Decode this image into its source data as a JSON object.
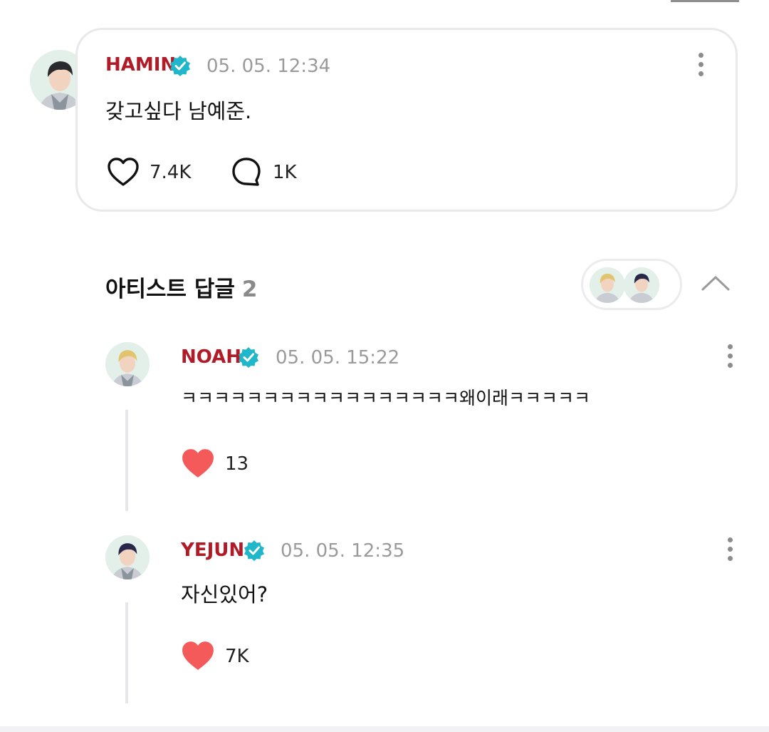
{
  "post": {
    "author": "HAMIN",
    "author_color": "#b11a27",
    "verified_color": "#1fb7c9",
    "timestamp": "05. 05. 12:34",
    "text": "갖고싶다 남예준.",
    "likes": "7.4K",
    "comments": "1K",
    "icons": {
      "like": "heart-outline-icon",
      "comment": "comment-bubble-icon",
      "more": "more-vertical-icon"
    }
  },
  "replies_section": {
    "title": "아티스트 답글",
    "count": "2",
    "participant_avatars": [
      "NOAH",
      "YEJUN"
    ]
  },
  "replies": [
    {
      "author": "NOAH",
      "timestamp": "05. 05. 15:22",
      "text": "ㅋㅋㅋㅋㅋㅋㅋㅋㅋㅋㅋㅋㅋㅋㅋㅋㅋ왜이래ㅋㅋㅋㅋㅋ",
      "likes": "13",
      "liked": true
    },
    {
      "author": "YEJUN",
      "timestamp": "05. 05. 12:35",
      "text": "자신있어?",
      "likes": "7K",
      "liked": true
    }
  ],
  "colors": {
    "heart_filled": "#f55a5a",
    "card_border": "#e9e9ec",
    "muted_text": "#9a9a9a"
  }
}
